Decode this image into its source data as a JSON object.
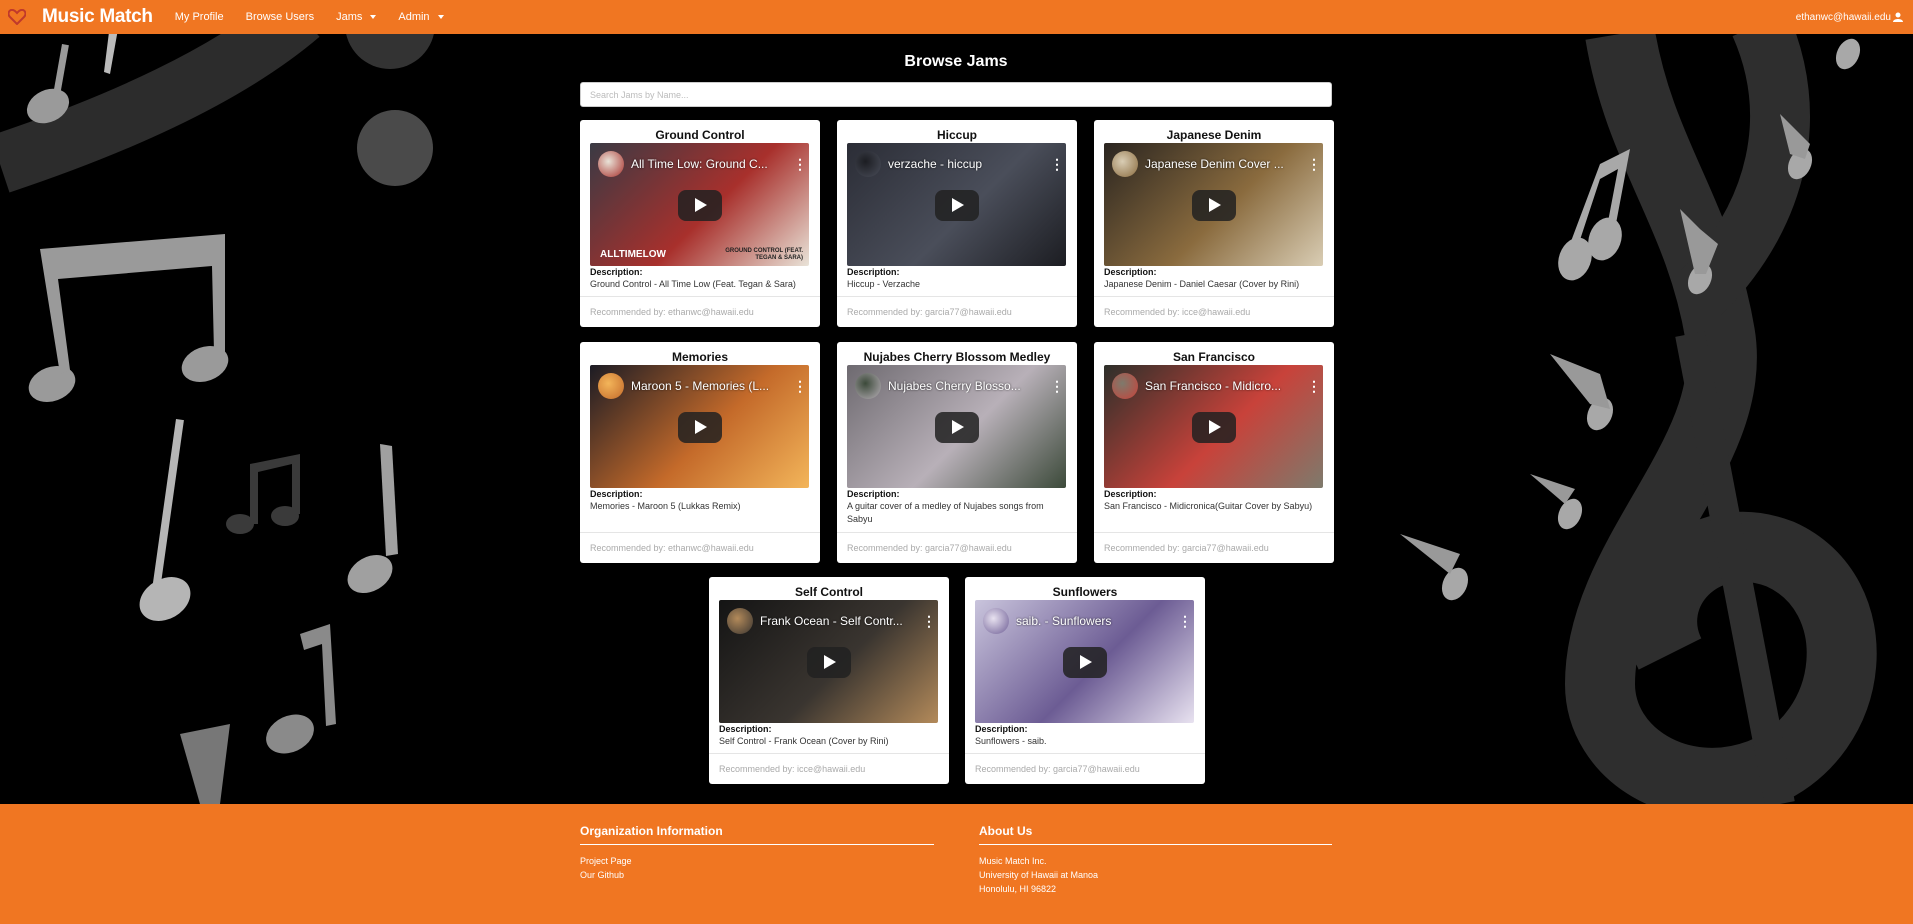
{
  "navbar": {
    "brand": "Music Match",
    "items": [
      "My Profile",
      "Browse Users",
      "Jams",
      "Admin"
    ],
    "user_email": "ethanwc@hawaii.edu"
  },
  "page": {
    "title": "Browse Jams",
    "search_placeholder": "Search Jams by Name..."
  },
  "labels": {
    "description": "Description:"
  },
  "jams": [
    {
      "title": "Ground Control",
      "video_title": "All Time Low: Ground C...",
      "description": "Ground Control - All Time Low (Feat. Tegan & Sara)",
      "recommended": "Recommended by: ethanwc@hawaii.edu",
      "thumb_colors": [
        "#3a3a44",
        "#a8302c",
        "#e9e3d8"
      ],
      "thumb_overlay_left": "ALLTIMELOW",
      "thumb_overlay_right": "GROUND CONTROL (FEAT. TEGAN & SARA)"
    },
    {
      "title": "Hiccup",
      "video_title": "verzache - hiccup",
      "description": "Hiccup - Verzache",
      "recommended": "Recommended by: garcia77@hawaii.edu",
      "thumb_colors": [
        "#2b2d36",
        "#4a4e5a",
        "#1c1d22"
      ]
    },
    {
      "title": "Japanese Denim",
      "video_title": "Japanese Denim Cover ...",
      "description": "Japanese Denim - Daniel Caesar (Cover by Rini)",
      "recommended": "Recommended by: icce@hawaii.edu",
      "thumb_colors": [
        "#2a2520",
        "#8a6b3e",
        "#d9cdb4"
      ]
    },
    {
      "title": "Memories",
      "video_title": "Maroon 5 - Memories (L...",
      "description": "Memories - Maroon 5 (Lukkas Remix)",
      "recommended": "Recommended by: ethanwc@hawaii.edu",
      "thumb_colors": [
        "#1b1b24",
        "#c46a2a",
        "#f3b55a"
      ]
    },
    {
      "title": "Nujabes Cherry Blossom Medley",
      "video_title": "Nujabes Cherry Blosso...",
      "description": "A guitar cover of a medley of Nujabes songs from Sabyu",
      "recommended": "Recommended by: garcia77@hawaii.edu",
      "thumb_colors": [
        "#6e6a70",
        "#b8b0b8",
        "#3c4a3a"
      ]
    },
    {
      "title": "San Francisco",
      "video_title": "San Francisco - Midicro...",
      "description": "San Francisco - Midicronica(Guitar Cover by Sabyu)",
      "recommended": "Recommended by: garcia77@hawaii.edu",
      "thumb_colors": [
        "#2d2f2a",
        "#c8423a",
        "#7e7a6c"
      ]
    },
    {
      "title": "Self Control",
      "video_title": "Frank Ocean - Self Contr...",
      "description": "Self Control - Frank Ocean (Cover by Rini)",
      "recommended": "Recommended by: icce@hawaii.edu",
      "thumb_colors": [
        "#141414",
        "#3a3530",
        "#b38a5a"
      ]
    },
    {
      "title": "Sunflowers",
      "video_title": "saib. - Sunflowers",
      "description": "Sunflowers - saib.",
      "recommended": "Recommended by: garcia77@hawaii.edu",
      "thumb_colors": [
        "#c9c4dc",
        "#6c5c94",
        "#e8e2f0"
      ]
    }
  ],
  "footer": {
    "org_heading": "Organization Information",
    "org_links": [
      "Project Page",
      "Our Github"
    ],
    "about_heading": "About Us",
    "about_lines": [
      "Music Match Inc.",
      "University of Hawaii at Manoa",
      "Honolulu, HI 96822"
    ]
  },
  "colors": {
    "brand_orange": "#f07622",
    "background": "#000000",
    "note_gray": "#8f8f8f",
    "clef_gray": "#2e2e2e"
  }
}
